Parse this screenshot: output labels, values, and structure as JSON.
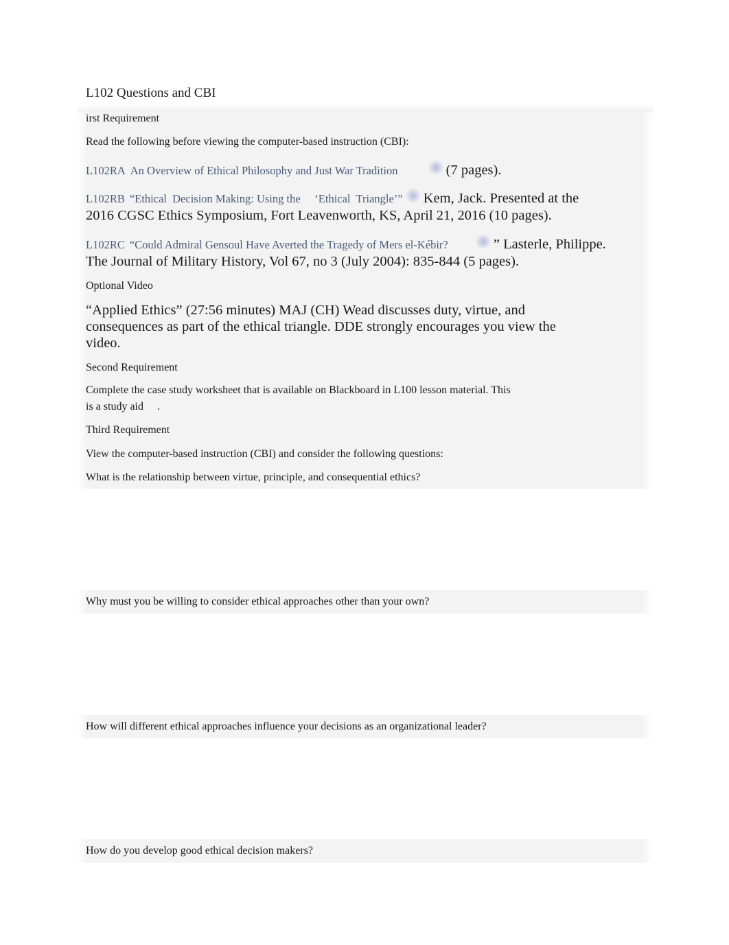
{
  "document": {
    "title": "L102 Questions and CBI",
    "first_requirement": {
      "heading": "irst Requirement",
      "intro": "Read the following before viewing the computer-based instruction (CBI):",
      "readings": [
        {
          "code": "L102RA",
          "link_text": "An Overview of Ethical Philosophy and Just War Tradition",
          "suffix_line1": "(7 pages).",
          "suffix_line2": ""
        },
        {
          "code": "L102RB",
          "link_text": "“Ethical  Decision Making: Using the     ‘Ethical  Triangle’”",
          "suffix_line1": "Kem, Jack. Presented at the",
          "suffix_line2": "2016 CGSC Ethics Symposium, Fort Leavenworth, KS, April 21, 2016 (10 pages)."
        },
        {
          "code": "L102RC",
          "link_text": "“Could  Admiral Gensoul Have Averted the Tragedy of Mers el-Kébir?",
          "suffix_line1": "” Lasterle, Philippe.",
          "suffix_line2": "The Journal of Military History, Vol 67, no 3 (July 2004): 835-844 (5 pages)."
        }
      ]
    },
    "optional_video": {
      "heading": "Optional Video",
      "lines": [
        "“Applied Ethics” (27:56 minutes) MAJ (CH) Wead discusses duty, virtue, and",
        "consequences as part of the ethical triangle. DDE strongly encourages you view the",
        "video."
      ]
    },
    "second_requirement": {
      "heading": "Second Requirement",
      "lines": [
        "Complete the case study worksheet that is available on Blackboard in L100 lesson material. This",
        "is a study aid     ."
      ]
    },
    "third_requirement": {
      "heading": "Third Requirement",
      "intro": "View the computer-based instruction (CBI) and consider the following questions:",
      "questions": [
        "What is the relationship between virtue, principle, and consequential ethics?",
        "Why must you be willing to consider ethical approaches other than your own?",
        "How will different ethical approaches influence your decisions as an organizational leader?",
        "How do you develop good ethical decision makers?"
      ]
    }
  }
}
